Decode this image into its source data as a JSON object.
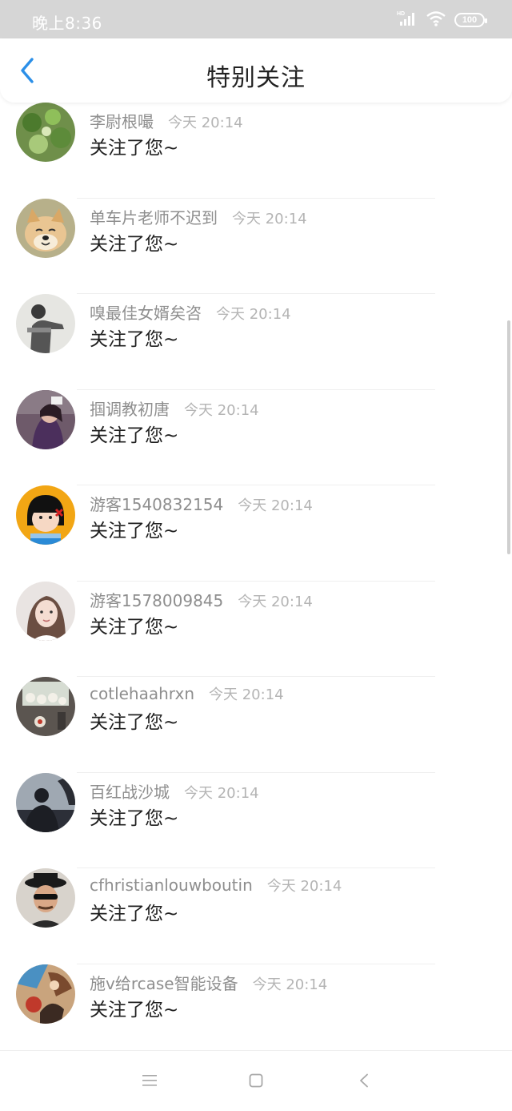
{
  "status_bar": {
    "time": "晚上8:36",
    "battery": "100",
    "icons": [
      "hd-signal-icon",
      "wifi-icon",
      "battery-icon"
    ]
  },
  "header": {
    "title": "特别关注",
    "back_icon": "chevron-left-icon",
    "accent_color": "#2b8fe8"
  },
  "notifications": [
    {
      "name": "李尉根嘬",
      "time": "今天 20:14",
      "message": "关注了您~",
      "avatar": "clover-plant-avatar"
    },
    {
      "name": "单车片老师不迟到",
      "time": "今天 20:14",
      "message": "关注了您~",
      "avatar": "shiba-dog-avatar"
    },
    {
      "name": "嗅最佳女婿矣咨",
      "time": "今天 20:14",
      "message": "关注了您~",
      "avatar": "person-pose-avatar"
    },
    {
      "name": "掴调教初唐",
      "time": "今天 20:14",
      "message": "关注了您~",
      "avatar": "girl-purple-avatar"
    },
    {
      "name": "游客1540832154",
      "time": "今天 20:14",
      "message": "关注了您~",
      "avatar": "cartoon-girl-avatar"
    },
    {
      "name": "游客1578009845",
      "time": "今天 20:14",
      "message": "关注了您~",
      "avatar": "girl-portrait-avatar"
    },
    {
      "name": "cotlehaahrxn",
      "time": "今天 20:14",
      "message": "关注了您~",
      "avatar": "window-decor-avatar"
    },
    {
      "name": "百红战沙城",
      "time": "今天 20:14",
      "message": "关注了您~",
      "avatar": "silhouette-sky-avatar"
    },
    {
      "name": "cfhristianlouwboutin",
      "time": "今天 20:14",
      "message": "关注了您~",
      "avatar": "man-hat-avatar"
    },
    {
      "name": "施v给rcase智能设备",
      "time": "今天 20:14",
      "message": "关注了您~",
      "avatar": "colorful-art-avatar"
    }
  ],
  "nav_bar": {
    "buttons": [
      "menu-icon",
      "home-square-icon",
      "back-triangle-icon"
    ]
  }
}
